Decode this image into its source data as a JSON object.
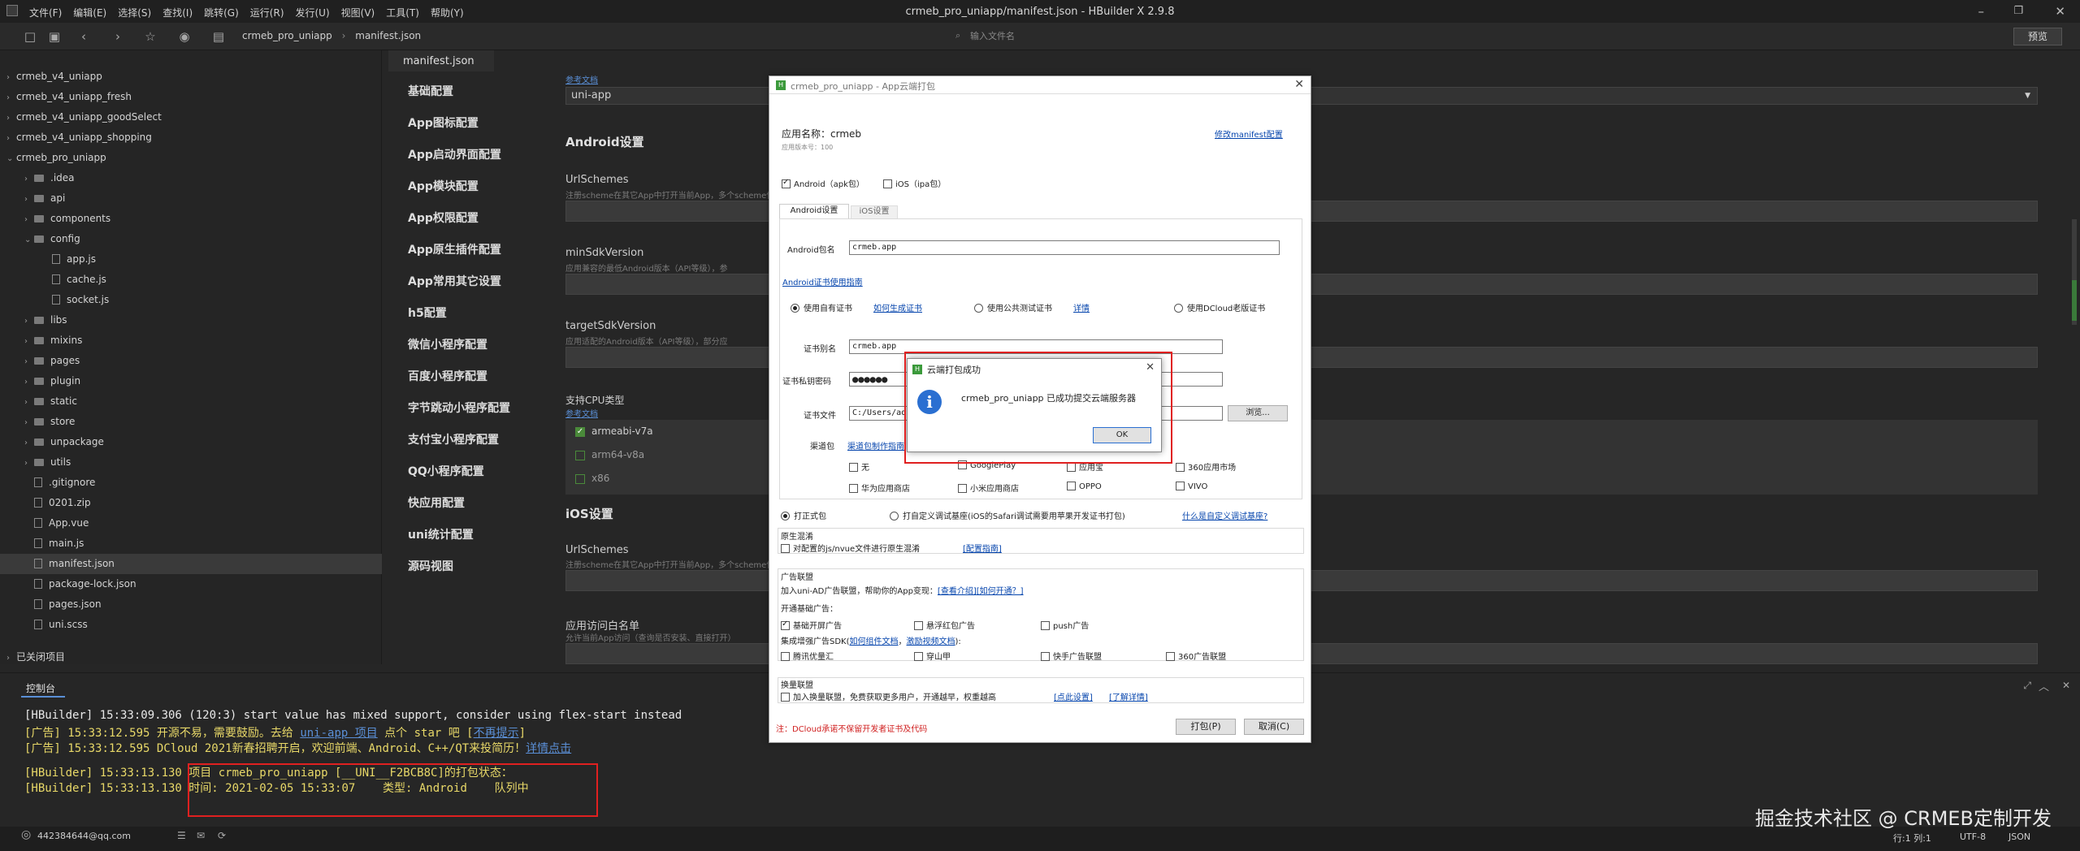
{
  "window": {
    "title": "crmeb_pro_uniapp/manifest.json - HBuilder X 2.9.8",
    "menu": [
      "文件(F)",
      "编辑(E)",
      "选择(S)",
      "查找(I)",
      "跳转(G)",
      "运行(R)",
      "发行(U)",
      "视图(V)",
      "工具(T)",
      "帮助(Y)"
    ],
    "preview_button": "预览"
  },
  "toolbar": {
    "breadcrumb": [
      "crmeb_pro_uniapp",
      "manifest.json"
    ],
    "search_placeholder": "输入文件名"
  },
  "sidebar": {
    "items": [
      {
        "label": "crmeb_v4_uniapp",
        "type": "project",
        "depth": 0,
        "expanded": false
      },
      {
        "label": "crmeb_v4_uniapp_fresh",
        "type": "project",
        "depth": 0,
        "expanded": false
      },
      {
        "label": "crmeb_v4_uniapp_goodSelect",
        "type": "project",
        "depth": 0,
        "expanded": false
      },
      {
        "label": "crmeb_v4_uniapp_shopping",
        "type": "project",
        "depth": 0,
        "expanded": false
      },
      {
        "label": "crmeb_pro_uniapp",
        "type": "project",
        "depth": 0,
        "expanded": true
      },
      {
        "label": ".idea",
        "type": "folder",
        "depth": 1,
        "expanded": false
      },
      {
        "label": "api",
        "type": "folder",
        "depth": 1,
        "expanded": false
      },
      {
        "label": "components",
        "type": "folder",
        "depth": 1,
        "expanded": false
      },
      {
        "label": "config",
        "type": "folder",
        "depth": 1,
        "expanded": true
      },
      {
        "label": "app.js",
        "type": "file",
        "depth": 2
      },
      {
        "label": "cache.js",
        "type": "file",
        "depth": 2
      },
      {
        "label": "socket.js",
        "type": "file",
        "depth": 2
      },
      {
        "label": "libs",
        "type": "folder",
        "depth": 1,
        "expanded": false
      },
      {
        "label": "mixins",
        "type": "folder",
        "depth": 1,
        "expanded": false
      },
      {
        "label": "pages",
        "type": "folder",
        "depth": 1,
        "expanded": false
      },
      {
        "label": "plugin",
        "type": "folder",
        "depth": 1,
        "expanded": false
      },
      {
        "label": "static",
        "type": "folder",
        "depth": 1,
        "expanded": false
      },
      {
        "label": "store",
        "type": "folder",
        "depth": 1,
        "expanded": false
      },
      {
        "label": "unpackage",
        "type": "folder",
        "depth": 1,
        "expanded": false
      },
      {
        "label": "utils",
        "type": "folder",
        "depth": 1,
        "expanded": false
      },
      {
        "label": ".gitignore",
        "type": "file",
        "depth": 1
      },
      {
        "label": "0201.zip",
        "type": "file",
        "depth": 1
      },
      {
        "label": "App.vue",
        "type": "file",
        "depth": 1
      },
      {
        "label": "main.js",
        "type": "file",
        "depth": 1
      },
      {
        "label": "manifest.json",
        "type": "file",
        "depth": 1,
        "selected": true
      },
      {
        "label": "package-lock.json",
        "type": "file",
        "depth": 1
      },
      {
        "label": "pages.json",
        "type": "file",
        "depth": 1
      },
      {
        "label": "uni.scss",
        "type": "file",
        "depth": 1
      }
    ],
    "closed_projects": "已关闭项目"
  },
  "editor": {
    "tab": "manifest.json",
    "nav": [
      "基础配置",
      "App图标配置",
      "App启动界面配置",
      "App模块配置",
      "App权限配置",
      "App原生插件配置",
      "App常用其它设置",
      "h5配置",
      "微信小程序配置",
      "百度小程序配置",
      "字节跳动小程序配置",
      "支付宝小程序配置",
      "QQ小程序配置",
      "快应用配置",
      "uni统计配置",
      "源码视图"
    ],
    "top_link": "参考文档",
    "select_value": "uni-app",
    "android_title": "Android设置",
    "urlschemes_label": "UrlSchemes",
    "urlschemes_hint": "注册scheme在其它App中打开当前App，多个scheme使用",
    "minsdk_label": "minSdkVersion",
    "minsdk_hint": "应用兼容的最低Android版本（API等级），参",
    "targetsdk_label": "targetSdkVersion",
    "targetsdk_hint": "应用适配的Android版本（API等级），部分应",
    "cpu_label": "支持CPU类型",
    "cpu_link": "参考文档",
    "cpu_options": [
      {
        "label": "armeabi-v7a",
        "checked": true
      },
      {
        "label": "arm64-v8a",
        "checked": false
      },
      {
        "label": "x86",
        "checked": false
      }
    ],
    "ios_title": "iOS设置",
    "ios_urlschemes_label": "UrlSchemes",
    "ios_urlschemes_hint": "注册scheme在其它App中打开当前App，多个scheme使用",
    "whitelist_label": "应用访问白名单",
    "whitelist_hint": "允许当前App访问（查询是否安装、直接打开）"
  },
  "dialog": {
    "title": "crmeb_pro_uniapp - App云端打包",
    "app_name_label": "应用名称：",
    "app_name": "crmeb",
    "app_version_label": "应用版本号：",
    "app_version": "100",
    "modify_link": "修改manifest配置",
    "android_pkg_label": "Android（apk包）",
    "ios_pkg_label": "iOS（ipa包）",
    "tab_android": "Android设置",
    "tab_ios": "iOS设置",
    "pkg_name_label": "Android包名",
    "pkg_name": "crmeb.app",
    "cert_guide_link": "Android证书使用指南",
    "cert_own": "使用自有证书",
    "cert_own_link": "如何生成证书",
    "cert_public": "使用公共测试证书",
    "cert_public_link": "详情",
    "cert_dcloud": "使用DCloud老版证书",
    "alias_label": "证书别名",
    "alias_value": "crmeb.app",
    "pwd_label": "证书私钥密码",
    "pwd_value": "●●●●●●",
    "file_label": "证书文件",
    "file_value": "C:/Users/ad",
    "browse": "浏览...",
    "channel_label": "渠道包",
    "channel_link": "渠道包制作指南",
    "channels": [
      "无",
      "GooglePlay",
      "应用宝",
      "360应用市场",
      "华为应用商店",
      "小米应用商店",
      "OPPO",
      "VIVO"
    ],
    "build_formal": "打正式包",
    "build_custom": "打自定义调试基座(iOS的Safari调试需要用苹果开发证书打包)",
    "custom_link": "什么是自定义调试基座?",
    "native_group": "原生混淆",
    "native_text": "对配置的js/nvue文件进行原生混淆",
    "native_link": "[配置指南]",
    "ad_group": "广告联盟",
    "ad_intro": "加入uni-AD广告联盟，帮助你的App变现：",
    "ad_intro_link": "[查看介绍]",
    "ad_open_link": "[如何开通？]",
    "ad_basic": "开通基础广告：",
    "ad_basic_opts": [
      {
        "label": "基础开屏广告",
        "checked": true
      },
      {
        "label": "悬浮红包广告",
        "checked": false
      },
      {
        "label": "push广告",
        "checked": false
      }
    ],
    "ad_sdk": "集成增强广告SDK(",
    "ad_sdk_link1": "如何组件文档",
    "ad_sdk_link2": "激励视频文档",
    "ad_sdk_tail": "):",
    "ad_sdk_opts": [
      "腾讯优量汇",
      "穿山甲",
      "快手广告联盟",
      "360广告联盟"
    ],
    "exchange_group": "换量联盟",
    "exchange_text": "加入换量联盟，免费获取更多用户，开通越早，权重越高",
    "exchange_link1": "[点此设置]",
    "exchange_link2": "[了解详情]",
    "note": "注：DCloud承诺不保留开发者证书及代码",
    "pack_button": "打包(P)",
    "cancel_button": "取消(C)"
  },
  "msgbox": {
    "title": "云端打包成功",
    "message": "crmeb_pro_uniapp 已成功提交云端服务器",
    "ok": "OK"
  },
  "console": {
    "tab": "控制台",
    "lines": [
      {
        "prefix": "[HBuilder] ",
        "time": "15:33:09.306",
        "text": " (120:3) start value has mixed support, consider using flex-start instead",
        "color": "#e8e8e8"
      },
      {
        "prefix": "[广告] ",
        "time": "15:33:12.595",
        "text": " 开源不易，需要鼓励。去给 ",
        "link": "uni-app 项目",
        "tail": " 点个 star 吧 [",
        "link2": "不再提示",
        "tail2": "]",
        "color": "#e8d868"
      },
      {
        "prefix": "[广告] ",
        "time": "15:33:12.595",
        "text": " DCloud 2021新春招聘开启，欢迎前端、Android、C++/QT来投简历！",
        "link": "详情点击",
        "color": "#e8d868"
      },
      {
        "prefix": "[HBuilder] ",
        "time": "15:33:13.130",
        "text": " 项目 crmeb_pro_uniapp [__UNI__F2BCB8C]的打包状态：",
        "color": "#e8d868"
      },
      {
        "prefix": "[HBuilder] ",
        "time": "15:33:13.130",
        "text": " 时间: 2021-02-05 15:33:07    类型: Android    队列中",
        "color": "#e8d868"
      }
    ]
  },
  "statusbar": {
    "user": "442384644@qq.com",
    "position": "行:1  列:1",
    "encoding": "UTF-8",
    "language": "JSON"
  },
  "watermark": "掘金技术社区 @ CRMEB定制开发",
  "colors": {
    "accent_red": "#e02020",
    "link_blue": "#5a8fd6",
    "console_yellow": "#e8d868"
  }
}
